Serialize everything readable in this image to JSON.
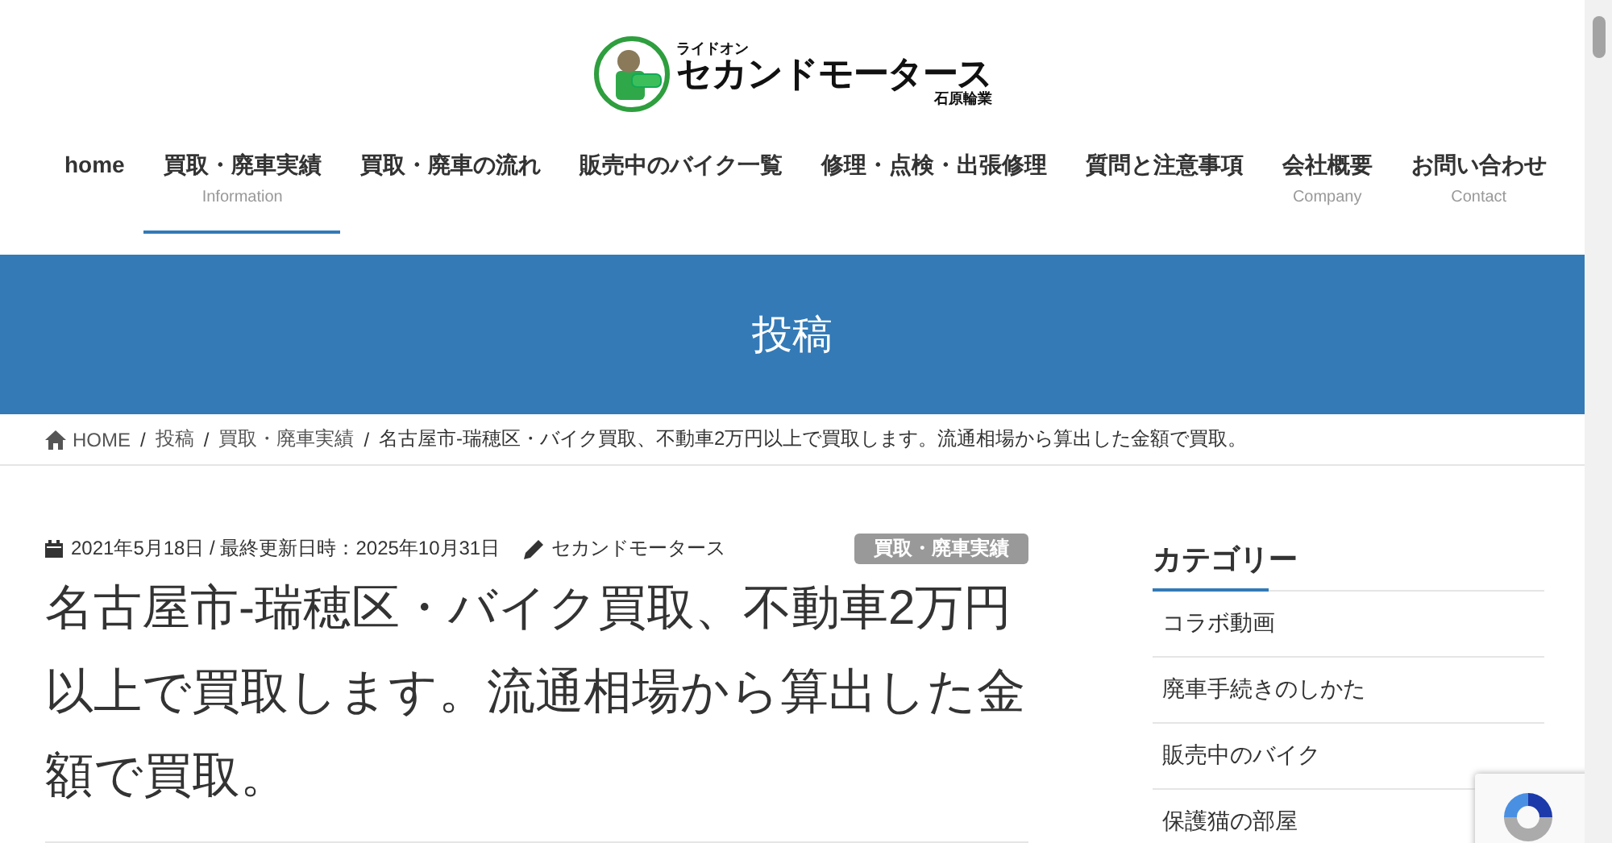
{
  "logo": {
    "tagline": "ライドオン",
    "name": "セカンドモータース",
    "company": "石原輪業"
  },
  "nav": [
    {
      "label": "home",
      "selected": false
    },
    {
      "label": "買取・廃車実績",
      "sublabel": "Information",
      "selected": true
    },
    {
      "label": "買取・廃車の流れ",
      "selected": false
    },
    {
      "label": "販売中のバイク一覧",
      "selected": false
    },
    {
      "label": "修理・点検・出張修理",
      "selected": false
    },
    {
      "label": "質問と注意事項",
      "selected": false
    },
    {
      "label": "会社概要",
      "sublabel": "Company",
      "selected": false
    },
    {
      "label": "お問い合わせ",
      "sublabel": "Contact",
      "selected": false
    }
  ],
  "page_banner": {
    "title": "投稿"
  },
  "breadcrumb": [
    {
      "kind": "home",
      "label": "HOME"
    },
    {
      "kind": "link",
      "separator": "/",
      "label": "投稿"
    },
    {
      "kind": "link",
      "separator": "/",
      "label": "買取・廃車実績"
    },
    {
      "kind": "current",
      "separator": "/",
      "label": "名古屋市-瑞穂区・バイク買取、不動車2万円以上で買取します。流通相場から算出した金額で買取。"
    }
  ],
  "post": {
    "dates": "2021年5月18日 / 最終更新日時：2025年10月31日",
    "author": "セカンドモータース",
    "category": "買取・廃車実績",
    "title": "名古屋市-瑞穂区・バイク買取、不動車2万円以上で買取します。流通相場から算出した金額で買取。"
  },
  "sidebar": {
    "heading": "カテゴリー",
    "items": [
      "コラボ動画",
      "廃車手続きのしかた",
      "販売中のバイク",
      "保護猫の部屋"
    ]
  }
}
